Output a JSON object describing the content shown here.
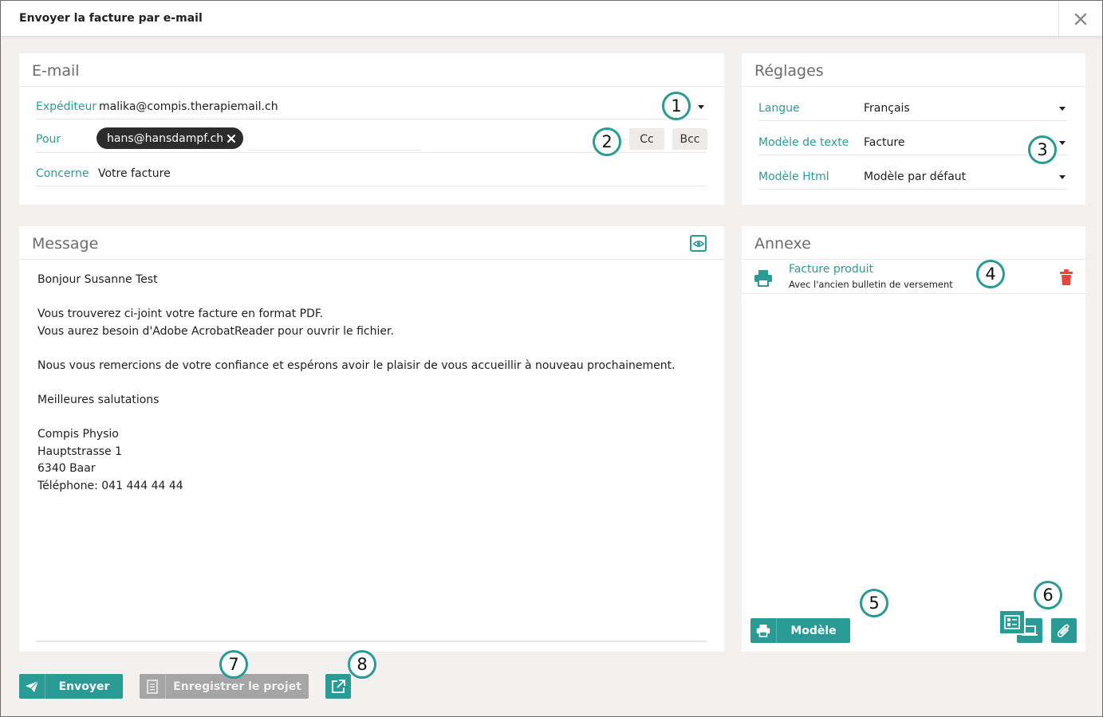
{
  "window": {
    "title": "Envoyer la facture par e-mail"
  },
  "email": {
    "title": "E-mail",
    "from_label": "Expéditeur",
    "from_value": "malika@compis.therapiemail.ch",
    "to_label": "Pour",
    "to_chip": "hans@hansdampf.ch",
    "cc_label": "Cc",
    "bcc_label": "Bcc",
    "subject_label": "Concerne",
    "subject_value": "Votre facture"
  },
  "settings": {
    "title": "Réglages",
    "language_label": "Langue",
    "language_value": "Français",
    "text_template_label": "Modèle de texte",
    "text_template_value": "Facture",
    "html_template_label": "Modèle Html",
    "html_template_value": "Modèle par défaut"
  },
  "message": {
    "title": "Message",
    "lines": [
      "Bonjour Susanne Test",
      "Vous trouverez ci-joint votre facture en format PDF.",
      "Vous aurez besoin d'Adobe AcrobatReader pour ouvrir le fichier.",
      "Nous vous remercions de votre confiance et espérons avoir le plaisir de vous accueillir à nouveau prochainement.",
      "Meilleures salutations",
      "Compis Physio",
      "Hauptstrasse 1",
      "6340 Baar",
      "Téléphone: 041 444 44 44"
    ]
  },
  "attachment": {
    "title": "Annexe",
    "item_title": "Facture produit",
    "item_subtitle": "Avec l'ancien bulletin de versement",
    "template_button": "Modèle"
  },
  "footer": {
    "send_label": "Envoyer",
    "save_project_label": "Enregistrer le projet"
  },
  "callouts": [
    "1",
    "2",
    "3",
    "4",
    "5",
    "6",
    "7",
    "8"
  ],
  "colors": {
    "accent": "#2a9a94",
    "danger": "#e2483d",
    "disabled": "#a5a5a5"
  },
  "icons": [
    "close-icon",
    "eye-icon",
    "printer-icon",
    "trash-icon",
    "send-icon",
    "document-icon",
    "external-link-icon",
    "list-icon",
    "laptop-icon",
    "paperclip-icon",
    "chevron-down-icon"
  ]
}
